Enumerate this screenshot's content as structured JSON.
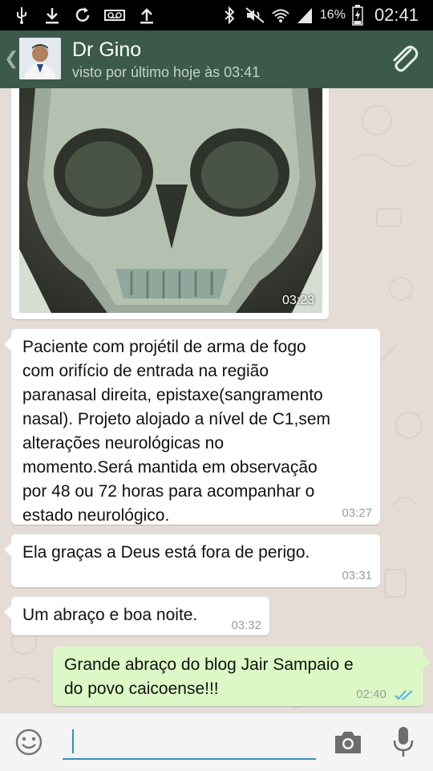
{
  "status_bar": {
    "icons_left": [
      "usb-icon",
      "download-icon",
      "sync-icon",
      "voicemail-icon",
      "upload-icon"
    ],
    "icons_right": [
      "bluetooth-icon",
      "mute-icon",
      "wifi-icon",
      "signal-icon"
    ],
    "battery_percent": "16%",
    "time": "02:41"
  },
  "header": {
    "contact_name": "Dr Gino",
    "last_seen": "visto por último hoje às 03:41"
  },
  "messages": [
    {
      "type": "image",
      "direction": "in",
      "time": "03:23"
    },
    {
      "type": "text",
      "direction": "in",
      "text": "Paciente com projétil de arma de fogo\ncom orifício de entrada na região\nparanasal direita, epistaxe(sangramento\nnasal). Projeto alojado a nível de C1,sem\nalterações neurológicas no\nmomento.Será mantida em observação\npor 48 ou 72 horas para acompanhar o\nestado neurológico.",
      "time": "03:27"
    },
    {
      "type": "text",
      "direction": "in",
      "text": "Ela graças a Deus está fora de perigo.",
      "time": "03:31"
    },
    {
      "type": "text",
      "direction": "in",
      "text": "Um abraço e boa noite.",
      "time": "03:32"
    },
    {
      "type": "text",
      "direction": "out",
      "text": "Grande abraço do blog Jair Sampaio e\ndo povo caicoense!!!",
      "time": "02:40",
      "status": "read"
    }
  ],
  "input": {
    "placeholder": ""
  },
  "colors": {
    "header": "#3b5a4b",
    "outgoing_bubble": "#dcf8c6",
    "incoming_bubble": "#ffffff",
    "read_ticks": "#4fb3e8"
  }
}
